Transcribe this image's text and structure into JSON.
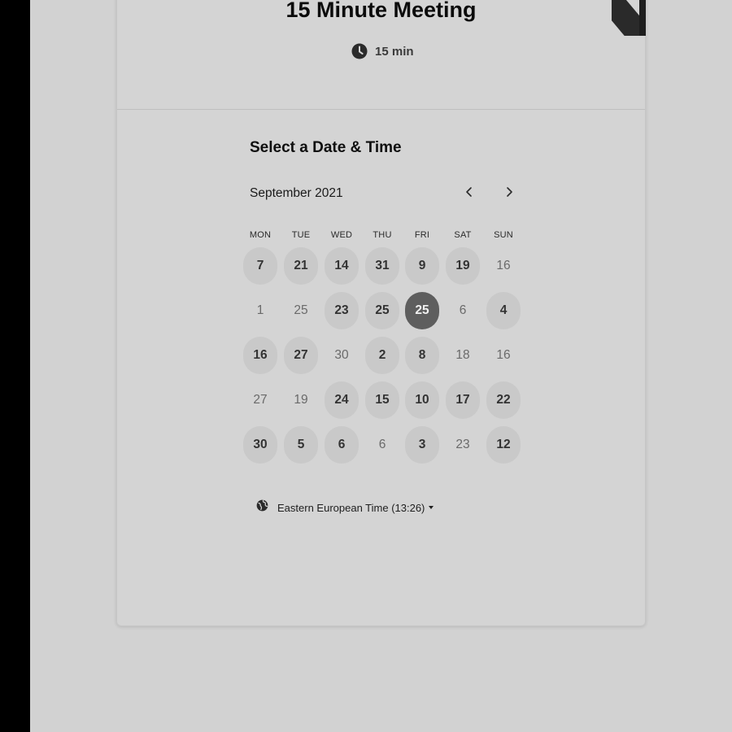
{
  "event": {
    "title": "15 Minute Meeting",
    "duration": "15 min"
  },
  "picker": {
    "title": "Select a Date & Time",
    "month": "September 2021"
  },
  "weekdays": [
    "MON",
    "TUE",
    "WED",
    "THU",
    "FRI",
    "SAT",
    "SUN"
  ],
  "weeks": [
    [
      {
        "label": "7",
        "state": "available"
      },
      {
        "label": "21",
        "state": "available"
      },
      {
        "label": "14",
        "state": "available"
      },
      {
        "label": "31",
        "state": "available"
      },
      {
        "label": "9",
        "state": "available"
      },
      {
        "label": "19",
        "state": "available"
      },
      {
        "label": "16",
        "state": "unavailable"
      }
    ],
    [
      {
        "label": "1",
        "state": "unavailable"
      },
      {
        "label": "25",
        "state": "unavailable"
      },
      {
        "label": "23",
        "state": "available"
      },
      {
        "label": "25",
        "state": "available"
      },
      {
        "label": "25",
        "state": "selected"
      },
      {
        "label": "6",
        "state": "unavailable"
      },
      {
        "label": "4",
        "state": "available"
      }
    ],
    [
      {
        "label": "16",
        "state": "available"
      },
      {
        "label": "27",
        "state": "available"
      },
      {
        "label": "30",
        "state": "unavailable"
      },
      {
        "label": "2",
        "state": "available"
      },
      {
        "label": "8",
        "state": "available"
      },
      {
        "label": "18",
        "state": "unavailable"
      },
      {
        "label": "16",
        "state": "unavailable"
      }
    ],
    [
      {
        "label": "27",
        "state": "unavailable"
      },
      {
        "label": "19",
        "state": "unavailable"
      },
      {
        "label": "24",
        "state": "available"
      },
      {
        "label": "15",
        "state": "available"
      },
      {
        "label": "10",
        "state": "available"
      },
      {
        "label": "17",
        "state": "available"
      },
      {
        "label": "22",
        "state": "available"
      }
    ],
    [
      {
        "label": "30",
        "state": "available"
      },
      {
        "label": "5",
        "state": "available"
      },
      {
        "label": "6",
        "state": "available"
      },
      {
        "label": "6",
        "state": "unavailable"
      },
      {
        "label": "3",
        "state": "available"
      },
      {
        "label": "23",
        "state": "unavailable"
      },
      {
        "label": "12",
        "state": "available"
      }
    ]
  ],
  "timezone": {
    "label": "Eastern European Time (13:26)"
  },
  "icons": {
    "duration": "clock-icon",
    "prev": "chevron-left-icon",
    "next": "chevron-right-icon",
    "timezone": "globe-icon",
    "dropdown": "caret-down-icon"
  }
}
